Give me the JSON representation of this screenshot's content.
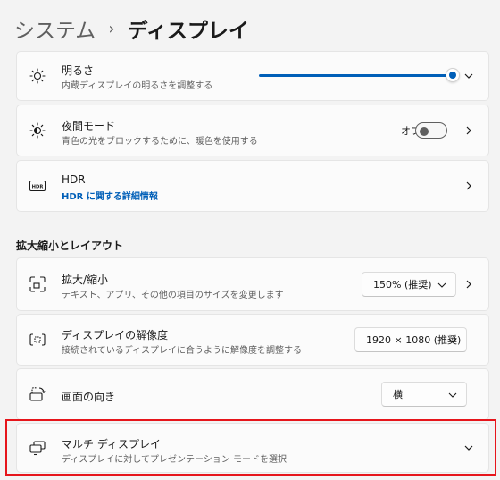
{
  "breadcrumb": {
    "parent": "システム",
    "separator": "›",
    "current": "ディスプレイ"
  },
  "brightness": {
    "title": "明るさ",
    "subtitle": "内蔵ディスプレイの明るさを調整する",
    "level_percent": 100
  },
  "night_light": {
    "title": "夜間モード",
    "subtitle": "青色の光をブロックするために、暖色を使用する",
    "toggle_label": "オフ"
  },
  "hdr": {
    "title": "HDR",
    "link": "HDR に関する詳細情報"
  },
  "section": {
    "scale_layout": "拡大縮小とレイアウト"
  },
  "scale": {
    "title": "拡大/縮小",
    "subtitle": "テキスト、アプリ、その他の項目のサイズを変更します",
    "value": "150% (推奨)"
  },
  "resolution": {
    "title": "ディスプレイの解像度",
    "subtitle": "接続されているディスプレイに合うように解像度を調整する",
    "value": "1920 × 1080 (推奨)"
  },
  "orientation": {
    "title": "画面の向き",
    "value": "横"
  },
  "multi_display": {
    "title": "マルチ ディスプレイ",
    "subtitle": "ディスプレイに対してプレゼンテーション モードを選択"
  },
  "colors": {
    "accent": "#005fb8",
    "highlight": "#e6151b"
  }
}
